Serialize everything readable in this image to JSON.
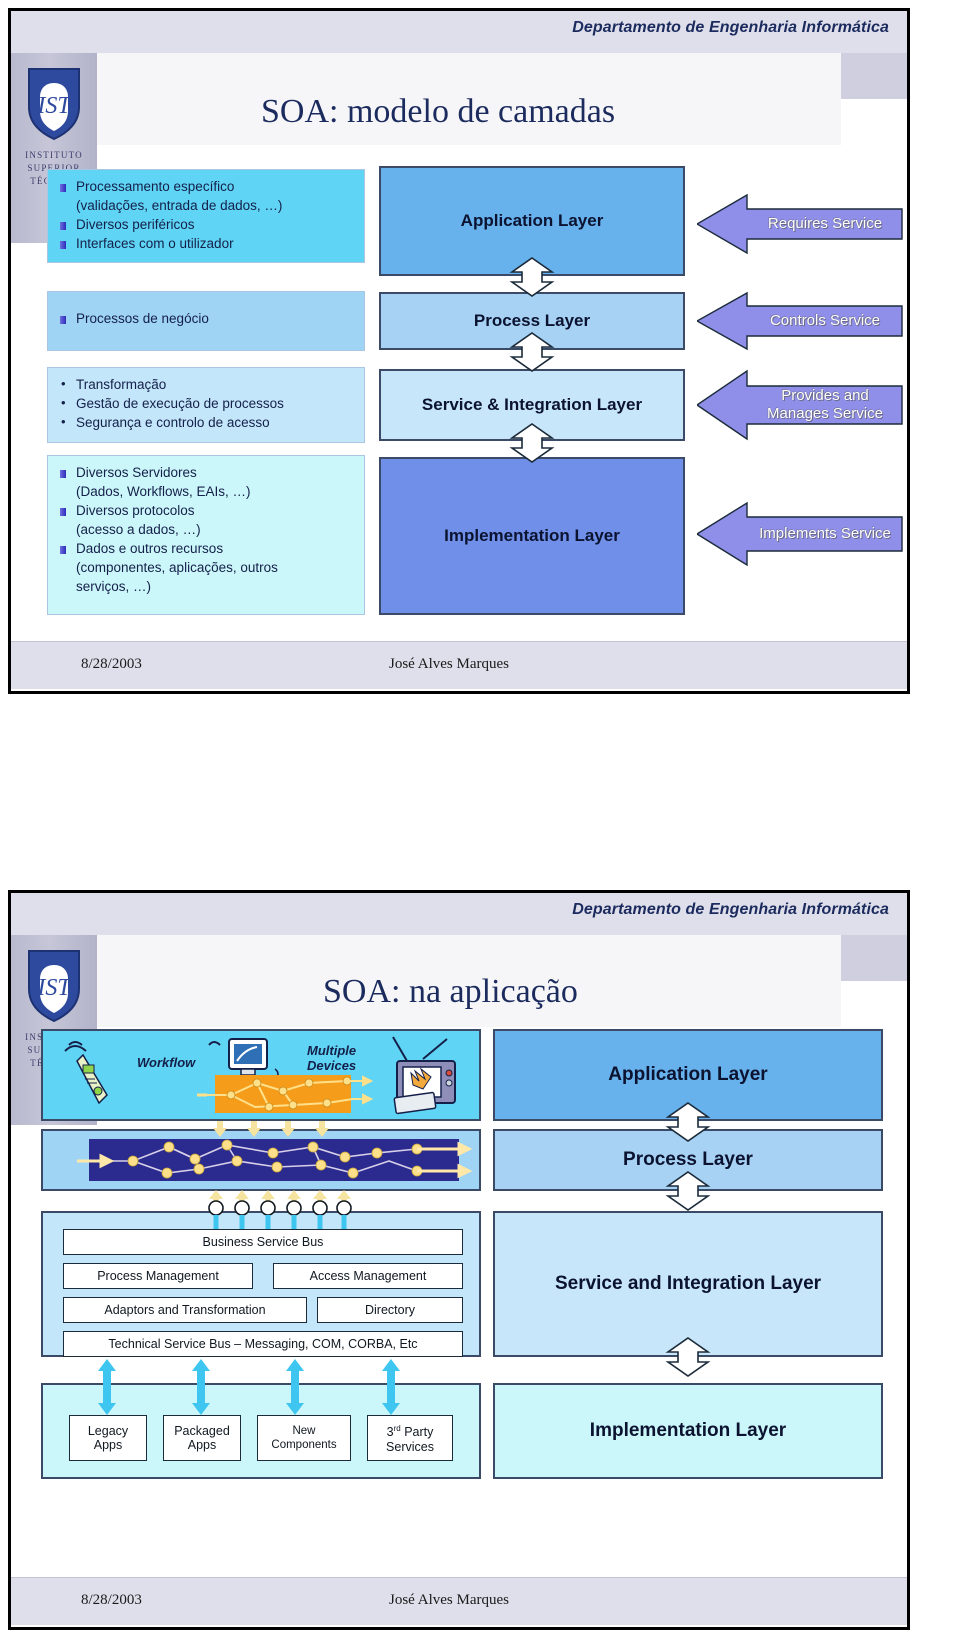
{
  "slide1": {
    "header": "Departamento de Engenharia Informática",
    "logo": {
      "line1": "INSTITUTO",
      "line2": "SUPERIOR",
      "line3": "TÉCNICO",
      "monogram": "IST"
    },
    "title": "SOA: modelo de camadas",
    "desc_boxes": [
      {
        "items": [
          "Processamento específico",
          "(validações, entrada de dados, …)",
          "Diversos periféricos",
          "Interfaces com o utilizador"
        ]
      },
      {
        "items": [
          "Processos de negócio"
        ]
      },
      {
        "items": [
          "Transformação",
          "Gestão de execução de processos",
          "Segurança e controlo de acesso"
        ]
      },
      {
        "items": [
          "Diversos Servidores",
          "(Dados, Workflows, EAIs, …)",
          "Diversos protocolos",
          "(acesso a dados, …)",
          "Dados e outros recursos",
          "(componentes, aplicações, outros",
          "serviços, …)"
        ]
      }
    ],
    "layers": [
      "Application Layer",
      "Process Layer",
      "Service & Integration Layer",
      "Implementation Layer"
    ],
    "arrows": [
      "Requires Service",
      "Controls Service",
      "Provides and\nManages Service",
      "Implements Service"
    ],
    "arrow_lines": [
      [
        "Requires Service"
      ],
      [
        "Controls Service"
      ],
      [
        "Provides and",
        "Manages Service"
      ],
      [
        "Implements Service"
      ]
    ],
    "footer": {
      "date": "8/28/2003",
      "author": "José Alves Marques"
    }
  },
  "slide2": {
    "header": "Departamento de Engenharia Informática",
    "logo": {
      "line1": "INSTITUTO",
      "line2": "SUPERIOR",
      "line3": "TÉCNICO",
      "monogram": "IST"
    },
    "title": "SOA: na aplicação",
    "illustration": {
      "workflow_label": "Workflow",
      "devices_label_line1": "Multiple",
      "devices_label_line2": "Devices"
    },
    "service_components": [
      "Business Service Bus",
      "Process Management",
      "Access Management",
      "Adaptors and Transformation",
      "Directory",
      "Technical Service Bus – Messaging, COM, CORBA, Etc"
    ],
    "implementation_components": [
      {
        "line1": "Legacy",
        "line2": "Apps"
      },
      {
        "line1": "Packaged",
        "line2": "Apps"
      },
      {
        "line1": "New",
        "line2": "Components"
      },
      {
        "line1": "3rd",
        "line2": "Party",
        "line3": "Services",
        "sup": "rd",
        "num": "3"
      }
    ],
    "right_layers": [
      "Application Layer",
      "Process Layer",
      "Service and Integration Layer",
      "Implementation Layer"
    ],
    "footer": {
      "date": "8/28/2003",
      "author": "José Alves Marques"
    }
  },
  "colors": {
    "header_band": "#dfdfeb",
    "title_text": "#1b2b5e",
    "application_layer": "#67b1ec",
    "process_layer": "#a7d2f4",
    "service_layer": "#c8e6fa",
    "implementation_layer": "#6f8fe8",
    "arrow_purple": "#8f8fea",
    "orange_band": "#f59c1a",
    "dark_band": "#2b2b8f",
    "cyan_connector": "#3ec6f0"
  }
}
